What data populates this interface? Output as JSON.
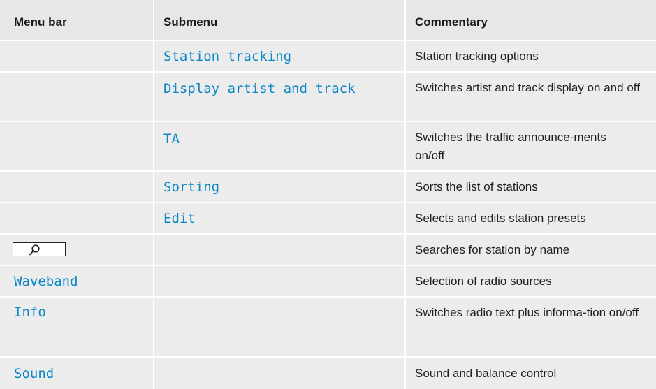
{
  "header": {
    "menu_bar": "Menu bar",
    "submenu": "Submenu",
    "commentary": "Commentary"
  },
  "rows": [
    {
      "menu": "",
      "submenu": "Station tracking",
      "commentary": "Station tracking options"
    },
    {
      "menu": "",
      "submenu": "Display artist and track",
      "commentary": "Switches artist and track display on and off"
    },
    {
      "menu": "",
      "submenu": "TA",
      "commentary": "Switches the traffic announce-ments on/off"
    },
    {
      "menu": "",
      "submenu": "Sorting",
      "commentary": "Sorts the list of stations"
    },
    {
      "menu": "",
      "submenu": "Edit",
      "commentary": "Selects and edits station presets"
    },
    {
      "menu_icon": "search-icon",
      "submenu": "",
      "commentary": "Searches for station by name"
    },
    {
      "menu": "Waveband",
      "submenu": "",
      "commentary": "Selection of radio sources"
    },
    {
      "menu": "Info",
      "submenu": "",
      "commentary": "Switches radio text plus informa-tion on/off"
    },
    {
      "menu": "Sound",
      "submenu": "",
      "commentary": "Sound and balance control"
    }
  ],
  "colors": {
    "cell_bg": "#ececec",
    "accent_mono": "#0a86c5",
    "text": "#1f1f1f"
  }
}
